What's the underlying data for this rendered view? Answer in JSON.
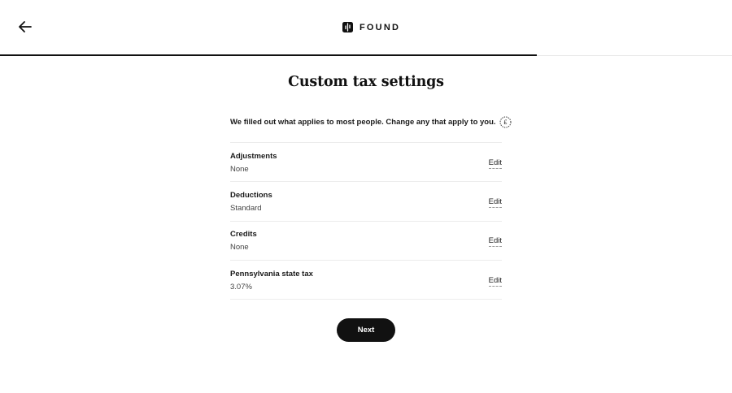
{
  "header": {
    "back_icon": "arrow-left-icon",
    "logo_icon": "found-logo-icon",
    "logo_text": "FOUND",
    "progress": 0.733
  },
  "main": {
    "title": "Custom tax settings",
    "intro": "We filled out what applies to most people. Change any that apply to you.",
    "info_icon": "info-dotted-icon",
    "rows": [
      {
        "label": "Adjustments",
        "value": "None",
        "action": "Edit"
      },
      {
        "label": "Deductions",
        "value": "Standard",
        "action": "Edit"
      },
      {
        "label": "Credits",
        "value": "None",
        "action": "Edit"
      },
      {
        "label": "Pennsylvania state tax",
        "value": "3.07%",
        "action": "Edit"
      }
    ],
    "next_label": "Next"
  }
}
